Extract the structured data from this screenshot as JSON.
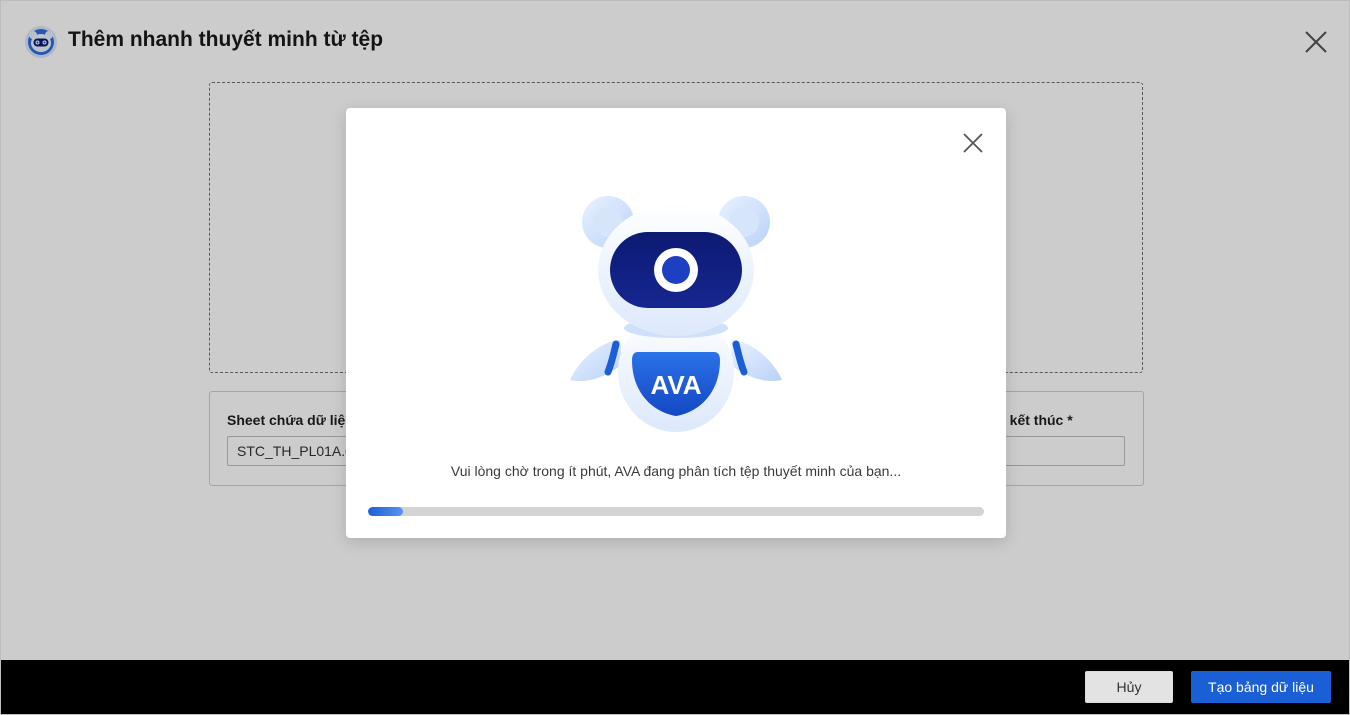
{
  "dialog": {
    "title": "Thêm nhanh thuyết minh từ tệp"
  },
  "settings": {
    "sheet_label": "Sheet chứa dữ liệu",
    "sheet_value": "STC_TH_PL01A.01",
    "end_label": "Dòng kết thúc *",
    "end_value": ""
  },
  "footer": {
    "cancel_label": "Hủy",
    "create_label": "Tạo bảng dữ liệu"
  },
  "loading_modal": {
    "mascot_badge": "AVA",
    "message": "Vui lòng chờ trong ít phút, AVA đang phân tích tệp thuyết minh của bạn...",
    "progress": 0.057
  },
  "colors": {
    "primary": "#1a5fd6",
    "footer_backdrop": "#000000",
    "mascot_visor": "#0c1a73"
  },
  "icons": {
    "app_logo": "robot-head-icon",
    "close": "close-x-icon"
  }
}
